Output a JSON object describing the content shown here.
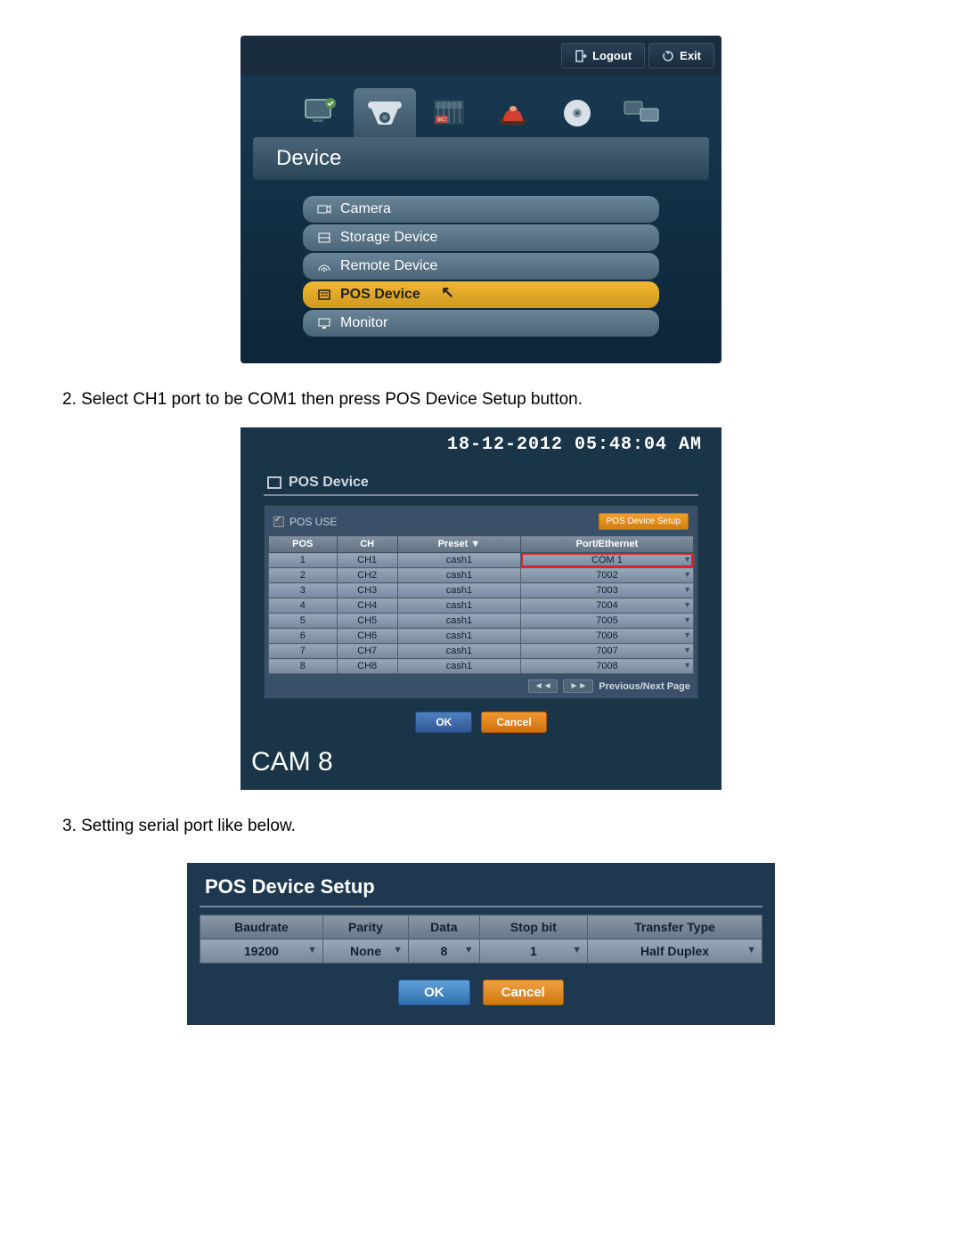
{
  "instructions": {
    "step2": "2. Select CH1 port to be COM1 then press POS Device Setup button.",
    "step3": "3. Setting serial port like below."
  },
  "shot1": {
    "topbar": {
      "logout": "Logout",
      "exit": "Exit"
    },
    "tab_title": "Device",
    "menu": {
      "camera": "Camera",
      "storage": "Storage Device",
      "remote": "Remote Device",
      "pos": "POS Device",
      "monitor": "Monitor"
    }
  },
  "shot2": {
    "timestamp": "18-12-2012 05:48:04 AM",
    "panel_title": "POS Device",
    "pos_use_label": "POS USE",
    "setup_btn": "POS Device Setup",
    "headers": {
      "pos": "POS",
      "ch": "CH",
      "preset": "Preset ▼",
      "port": "Port/Ethernet"
    },
    "rows": [
      {
        "pos": "1",
        "ch": "CH1",
        "preset": "cash1",
        "port": "COM 1"
      },
      {
        "pos": "2",
        "ch": "CH2",
        "preset": "cash1",
        "port": "7002"
      },
      {
        "pos": "3",
        "ch": "CH3",
        "preset": "cash1",
        "port": "7003"
      },
      {
        "pos": "4",
        "ch": "CH4",
        "preset": "cash1",
        "port": "7004"
      },
      {
        "pos": "5",
        "ch": "CH5",
        "preset": "cash1",
        "port": "7005"
      },
      {
        "pos": "6",
        "ch": "CH6",
        "preset": "cash1",
        "port": "7006"
      },
      {
        "pos": "7",
        "ch": "CH7",
        "preset": "cash1",
        "port": "7007"
      },
      {
        "pos": "8",
        "ch": "CH8",
        "preset": "cash1",
        "port": "7008"
      }
    ],
    "pager": {
      "prev": "◄◄",
      "next": "►►",
      "label": "Previous/Next Page"
    },
    "ok": "OK",
    "cancel": "Cancel",
    "cam": "CAM 8"
  },
  "shot3": {
    "title": "POS Device Setup",
    "headers": {
      "baudrate": "Baudrate",
      "parity": "Parity",
      "data": "Data",
      "stopbit": "Stop bit",
      "transfer": "Transfer Type"
    },
    "values": {
      "baudrate": "19200",
      "parity": "None",
      "data": "8",
      "stopbit": "1",
      "transfer": "Half Duplex"
    },
    "ok": "OK",
    "cancel": "Cancel"
  }
}
